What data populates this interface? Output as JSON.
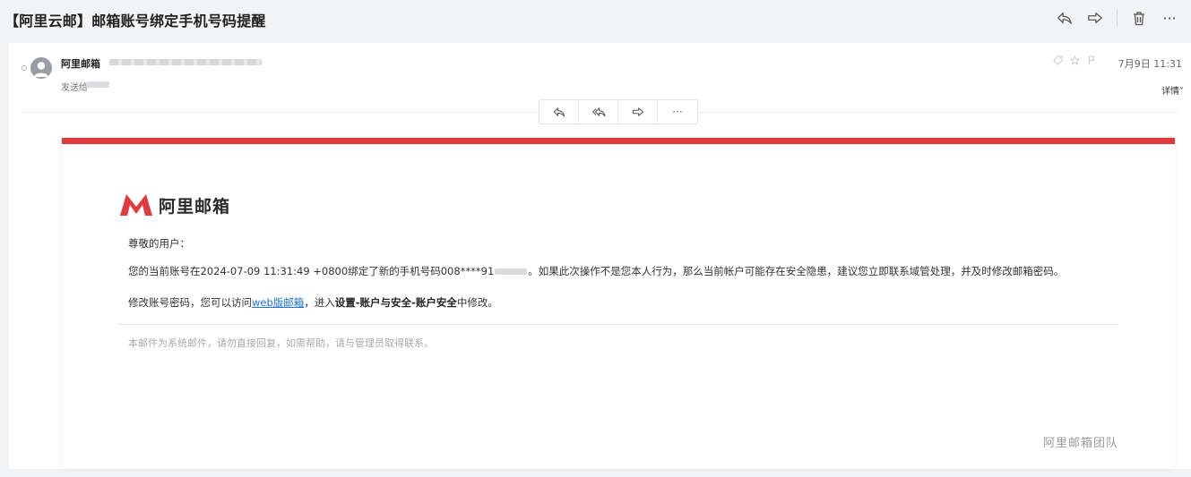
{
  "mail": {
    "subject": "【阿里云邮】邮箱账号绑定手机号码提醒",
    "sender_name": "阿里邮箱",
    "to_prefix": "发送给",
    "date": "7月9日 11:31",
    "details_label": "详情˅"
  },
  "body": {
    "brand": "阿里邮箱",
    "greeting": "尊敬的用户：",
    "p1_before": "您的当前账号在2024-07-09 11:31:49 +0800绑定了新的手机号码008****91",
    "p1_after": "。如果此次操作不是您本人行为，那么当前帐户可能存在安全隐患，建议您立即联系域管处理，并及时修改邮箱密码。",
    "p2_before": "修改账号密码，您可以访问",
    "p2_link": "web版邮箱",
    "p2_middle": "，进入",
    "p2_bold": "设置-账户与安全-账户安全",
    "p2_after": "中修改。",
    "note": "本邮件为系统邮件，请勿直接回复，如需帮助，请与管理员取得联系。",
    "team": "阿里邮箱团队"
  },
  "colors": {
    "accent_red": "#e0393e",
    "link_blue": "#1a73e8"
  },
  "icons": {
    "top": [
      "reply-icon",
      "forward-icon",
      "trash-icon",
      "more-icon"
    ],
    "toolbar": [
      "reply-icon",
      "reply-all-icon",
      "forward-icon",
      "more-icon"
    ],
    "meta": [
      "tag-icon",
      "star-icon",
      "flag-icon"
    ]
  },
  "toolbar": {
    "more_label": "···"
  },
  "top": {
    "more_label": "···"
  }
}
